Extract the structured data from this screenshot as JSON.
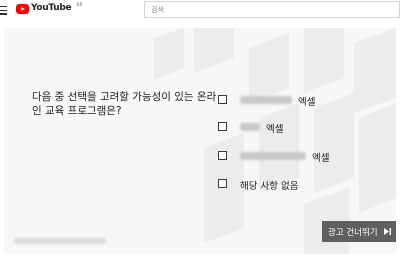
{
  "header": {
    "brand": "YouTube",
    "country": "KR",
    "search_placeholder": "검색"
  },
  "survey": {
    "question": "다음 중 선택을 고려할 가능성이 있는 온라인 교육 프로그램은?",
    "options": [
      {
        "suffix": "엑셀"
      },
      {
        "suffix": "엑셀"
      },
      {
        "suffix": "엑셀"
      },
      {
        "label": "해당 사항 없음"
      }
    ]
  },
  "skip_button": {
    "label": "광고 건너뛰기"
  },
  "colors": {
    "brand": "#ff0000",
    "skip_bg": "#5f5f5f",
    "player_bg": "#f7f7f7"
  }
}
